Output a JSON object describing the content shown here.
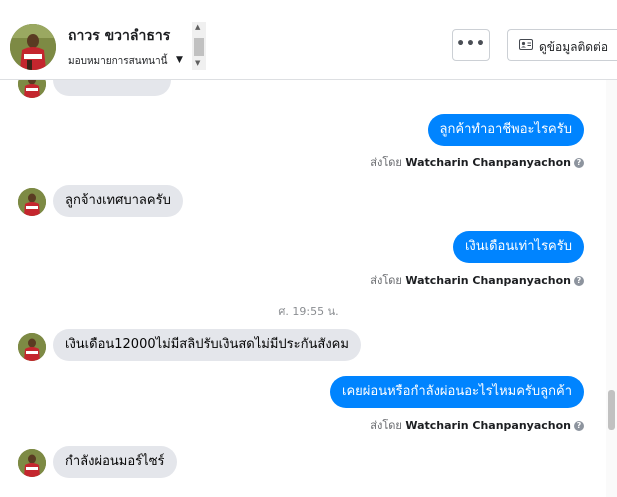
{
  "header": {
    "contact_name": "ถาวร ขวาลำธาร",
    "assign_label": "มอบหมายการสนทนานี้",
    "more_label": "•••",
    "info_label": "ดูข้อมูลติดต่อ"
  },
  "messages": [
    {
      "text": "ลูกค้าทำอาชีพอะไรครับ",
      "sent_by_prefix": "ส่งโดย",
      "sender": "Watcharin Chanpanyachon"
    },
    {
      "text": "ลูกจ้างเทศบาลครับ"
    },
    {
      "text": "เงินเดือนเท่าไรครับ",
      "sent_by_prefix": "ส่งโดย",
      "sender": "Watcharin Chanpanyachon"
    },
    {
      "text": "เงินเดือน12000ไม่มีสลิปรับเงินสดไม่มีประกันสังคม"
    },
    {
      "text": "เคยผ่อนหรือกำลังผ่อนอะไรไหมครับลูกค้า",
      "sent_by_prefix": "ส่งโดย",
      "sender": "Watcharin Chanpanyachon"
    },
    {
      "text": "กำลังผ่อนมอร์ไซร์"
    }
  ],
  "timestamp": "ศ. 19:55 น.",
  "help_glyph": "?",
  "colors": {
    "accent": "#0084ff",
    "incoming_bubble": "#e4e6eb"
  }
}
